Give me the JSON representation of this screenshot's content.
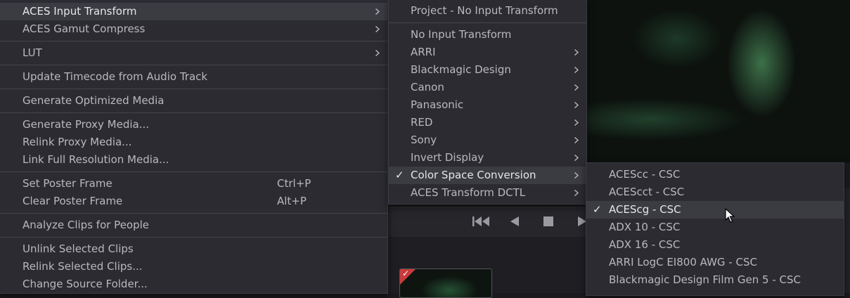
{
  "main_menu": {
    "items": [
      {
        "label": "ACES Input Transform",
        "submenu": true,
        "highlight": true
      },
      {
        "label": "ACES Gamut Compress",
        "submenu": true
      },
      {
        "sep": true
      },
      {
        "label": "LUT",
        "submenu": true
      },
      {
        "sep": true
      },
      {
        "label": "Update Timecode from Audio Track"
      },
      {
        "sep": true
      },
      {
        "label": "Generate Optimized Media"
      },
      {
        "sep": true
      },
      {
        "label": "Generate Proxy Media..."
      },
      {
        "label": "Relink Proxy Media..."
      },
      {
        "label": "Link Full Resolution Media..."
      },
      {
        "sep": true
      },
      {
        "label": "Set Poster Frame",
        "shortcut": "Ctrl+P"
      },
      {
        "label": "Clear Poster Frame",
        "shortcut": "Alt+P"
      },
      {
        "sep": true
      },
      {
        "label": "Analyze Clips for People"
      },
      {
        "sep": true
      },
      {
        "label": "Unlink Selected Clips"
      },
      {
        "label": "Relink Selected Clips..."
      },
      {
        "label": "Change Source Folder..."
      }
    ]
  },
  "input_transform_menu": {
    "items": [
      {
        "label": "Project - No Input Transform"
      },
      {
        "sep": true
      },
      {
        "label": "No Input Transform"
      },
      {
        "label": "ARRI",
        "submenu": true
      },
      {
        "label": "Blackmagic Design",
        "submenu": true
      },
      {
        "label": "Canon",
        "submenu": true
      },
      {
        "label": "Panasonic",
        "submenu": true
      },
      {
        "label": "RED",
        "submenu": true
      },
      {
        "label": "Sony",
        "submenu": true
      },
      {
        "label": "Invert Display",
        "submenu": true
      },
      {
        "label": "Color Space Conversion",
        "submenu": true,
        "checked": true,
        "highlight": true
      },
      {
        "label": "ACES Transform DCTL",
        "submenu": true
      }
    ]
  },
  "csc_menu": {
    "items": [
      {
        "label": "ACEScc - CSC"
      },
      {
        "label": "ACEScct - CSC"
      },
      {
        "label": "ACEScg - CSC",
        "checked": true,
        "highlight": true
      },
      {
        "label": "ADX 10 - CSC"
      },
      {
        "label": "ADX 16 - CSC"
      },
      {
        "label": "ARRI LogC EI800 AWG - CSC"
      },
      {
        "label": "Blackmagic Design Film Gen 5 - CSC"
      }
    ]
  },
  "transport": {
    "icons": [
      "skip-to-start-icon",
      "play-reverse-icon",
      "stop-icon",
      "play-icon"
    ]
  },
  "colors": {
    "menu_bg": "#2b2b31",
    "highlight_bg": "#3b3b42",
    "text": "#b9b9bd",
    "clip_flag": "#c93a3a"
  },
  "check_glyph": "✓"
}
